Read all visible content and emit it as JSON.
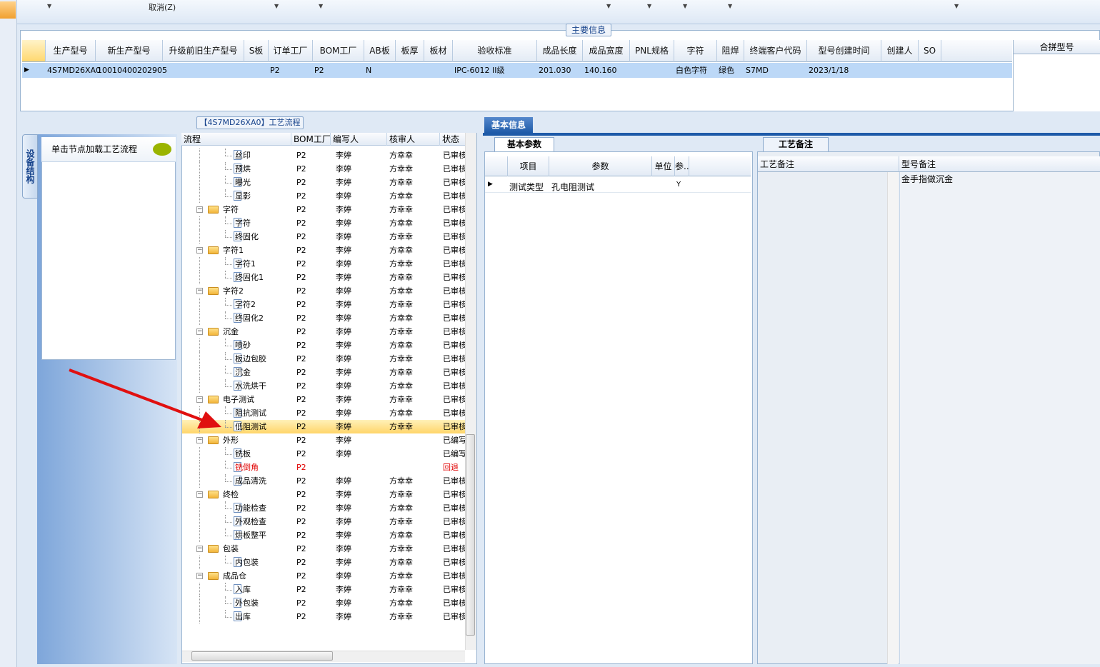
{
  "toolbar": {
    "cancel_label": "取消(Z)"
  },
  "main_info": {
    "tab_label": "主要信息",
    "columns": [
      "生产型号",
      "新生产型号",
      "升级前旧生产型号",
      "S板",
      "订单工厂",
      "BOM工厂",
      "AB板",
      "板厚",
      "板材",
      "验收标准",
      "成品长度",
      "成品宽度",
      "PNL规格",
      "字符",
      "阻焊",
      "终端客户代码",
      "型号创建时间",
      "创建人",
      "SO"
    ],
    "row": [
      "4S7MD26XA0",
      "10010400202905",
      "",
      "",
      "P2",
      "P2",
      "N",
      "",
      "",
      "IPC-6012 II级",
      "201.030",
      "140.160",
      "",
      "白色字符",
      "绿色",
      "S7MD",
      "2023/1/18",
      "",
      ""
    ],
    "combined_label": "合拼型号"
  },
  "process": {
    "title": "【4S7MD26XA0】工艺流程",
    "side_tab": "设备结构",
    "hint": "单击节点加载工艺流程",
    "columns": [
      "流程",
      "BOM工厂",
      "编写人",
      "核审人",
      "状态"
    ],
    "rows": [
      {
        "level": 1,
        "type": "doc",
        "name": "丝印",
        "bom": "P2",
        "writer": "李婷",
        "reviewer": "方幸幸",
        "status": "已审核"
      },
      {
        "level": 1,
        "type": "doc",
        "name": "预烘",
        "bom": "P2",
        "writer": "李婷",
        "reviewer": "方幸幸",
        "status": "已审核"
      },
      {
        "level": 1,
        "type": "doc",
        "name": "曝光",
        "bom": "P2",
        "writer": "李婷",
        "reviewer": "方幸幸",
        "status": "已审核"
      },
      {
        "level": 1,
        "type": "doc",
        "name": "显影",
        "bom": "P2",
        "writer": "李婷",
        "reviewer": "方幸幸",
        "status": "已审核"
      },
      {
        "level": 0,
        "type": "folder",
        "name": "字符",
        "bom": "P2",
        "writer": "李婷",
        "reviewer": "方幸幸",
        "status": "已审核"
      },
      {
        "level": 1,
        "type": "doc",
        "name": "字符",
        "bom": "P2",
        "writer": "李婷",
        "reviewer": "方幸幸",
        "status": "已审核"
      },
      {
        "level": 1,
        "type": "doc",
        "name": "终固化",
        "bom": "P2",
        "writer": "李婷",
        "reviewer": "方幸幸",
        "status": "已审核"
      },
      {
        "level": 0,
        "type": "folder",
        "name": "字符1",
        "bom": "P2",
        "writer": "李婷",
        "reviewer": "方幸幸",
        "status": "已审核"
      },
      {
        "level": 1,
        "type": "doc",
        "name": "字符1",
        "bom": "P2",
        "writer": "李婷",
        "reviewer": "方幸幸",
        "status": "已审核"
      },
      {
        "level": 1,
        "type": "doc",
        "name": "终固化1",
        "bom": "P2",
        "writer": "李婷",
        "reviewer": "方幸幸",
        "status": "已审核"
      },
      {
        "level": 0,
        "type": "folder",
        "name": "字符2",
        "bom": "P2",
        "writer": "李婷",
        "reviewer": "方幸幸",
        "status": "已审核"
      },
      {
        "level": 1,
        "type": "doc",
        "name": "字符2",
        "bom": "P2",
        "writer": "李婷",
        "reviewer": "方幸幸",
        "status": "已审核"
      },
      {
        "level": 1,
        "type": "doc",
        "name": "终固化2",
        "bom": "P2",
        "writer": "李婷",
        "reviewer": "方幸幸",
        "status": "已审核"
      },
      {
        "level": 0,
        "type": "folder",
        "name": "沉金",
        "bom": "P2",
        "writer": "李婷",
        "reviewer": "方幸幸",
        "status": "已审核"
      },
      {
        "level": 1,
        "type": "doc",
        "name": "喷砂",
        "bom": "P2",
        "writer": "李婷",
        "reviewer": "方幸幸",
        "status": "已审核"
      },
      {
        "level": 1,
        "type": "doc",
        "name": "板边包胶",
        "bom": "P2",
        "writer": "李婷",
        "reviewer": "方幸幸",
        "status": "已审核"
      },
      {
        "level": 1,
        "type": "doc",
        "name": "沉金",
        "bom": "P2",
        "writer": "李婷",
        "reviewer": "方幸幸",
        "status": "已审核"
      },
      {
        "level": 1,
        "type": "doc",
        "name": "水洗烘干",
        "bom": "P2",
        "writer": "李婷",
        "reviewer": "方幸幸",
        "status": "已审核"
      },
      {
        "level": 0,
        "type": "folder",
        "name": "电子测试",
        "bom": "P2",
        "writer": "李婷",
        "reviewer": "方幸幸",
        "status": "已审核"
      },
      {
        "level": 1,
        "type": "doc",
        "name": "阻抗测试",
        "bom": "P2",
        "writer": "李婷",
        "reviewer": "方幸幸",
        "status": "已审核"
      },
      {
        "level": 1,
        "type": "doc",
        "name": "低阻测试",
        "bom": "P2",
        "writer": "李婷",
        "reviewer": "方幸幸",
        "status": "已审核",
        "selected": true
      },
      {
        "level": 0,
        "type": "folder",
        "name": "外形",
        "bom": "P2",
        "writer": "李婷",
        "reviewer": "",
        "status": "已编写"
      },
      {
        "level": 1,
        "type": "doc",
        "name": "铣板",
        "bom": "P2",
        "writer": "李婷",
        "reviewer": "",
        "status": "已编写"
      },
      {
        "level": 1,
        "type": "doc",
        "name": "铣倒角",
        "bom": "P2",
        "writer": "",
        "reviewer": "",
        "status": "回退",
        "red": true
      },
      {
        "level": 1,
        "type": "doc",
        "name": "成品清洗",
        "bom": "P2",
        "writer": "李婷",
        "reviewer": "方幸幸",
        "status": "已审核"
      },
      {
        "level": 0,
        "type": "folder",
        "name": "终检",
        "bom": "P2",
        "writer": "李婷",
        "reviewer": "方幸幸",
        "status": "已审核"
      },
      {
        "level": 1,
        "type": "doc",
        "name": "功能检查",
        "bom": "P2",
        "writer": "李婷",
        "reviewer": "方幸幸",
        "status": "已审核"
      },
      {
        "level": 1,
        "type": "doc",
        "name": "外观检查",
        "bom": "P2",
        "writer": "李婷",
        "reviewer": "方幸幸",
        "status": "已审核"
      },
      {
        "level": 1,
        "type": "doc",
        "name": "烘板整平",
        "bom": "P2",
        "writer": "李婷",
        "reviewer": "方幸幸",
        "status": "已审核"
      },
      {
        "level": 0,
        "type": "folder",
        "name": "包装",
        "bom": "P2",
        "writer": "李婷",
        "reviewer": "方幸幸",
        "status": "已审核"
      },
      {
        "level": 1,
        "type": "doc",
        "name": "内包装",
        "bom": "P2",
        "writer": "李婷",
        "reviewer": "方幸幸",
        "status": "已审核"
      },
      {
        "level": 0,
        "type": "folder",
        "name": "成品仓",
        "bom": "P2",
        "writer": "李婷",
        "reviewer": "方幸幸",
        "status": "已审核"
      },
      {
        "level": 1,
        "type": "doc",
        "name": "入库",
        "bom": "P2",
        "writer": "李婷",
        "reviewer": "方幸幸",
        "status": "已审核"
      },
      {
        "level": 1,
        "type": "doc",
        "name": "外包装",
        "bom": "P2",
        "writer": "李婷",
        "reviewer": "方幸幸",
        "status": "已审核"
      },
      {
        "level": 1,
        "type": "doc",
        "name": "出库",
        "bom": "P2",
        "writer": "李婷",
        "reviewer": "方幸幸",
        "status": "已审核"
      }
    ]
  },
  "basic_info": {
    "tab_label": "基本信息",
    "param_tab": "基本参数",
    "param_columns": [
      "项目",
      "参数",
      "单位",
      "参.."
    ],
    "param_row": {
      "item": "测试类型",
      "value": "孔电阻测试",
      "unit": "",
      "flag": "Y"
    },
    "remarks_tab": "工艺备注",
    "remarks_col1": "工艺备注",
    "remarks_col2": "型号备注",
    "model_remark": "金手指做沉金"
  },
  "colors": {
    "accent": "#1e5aa8",
    "selected_row": "#ffd56a",
    "red_text": "#e00000",
    "arrow": "#e01010"
  }
}
